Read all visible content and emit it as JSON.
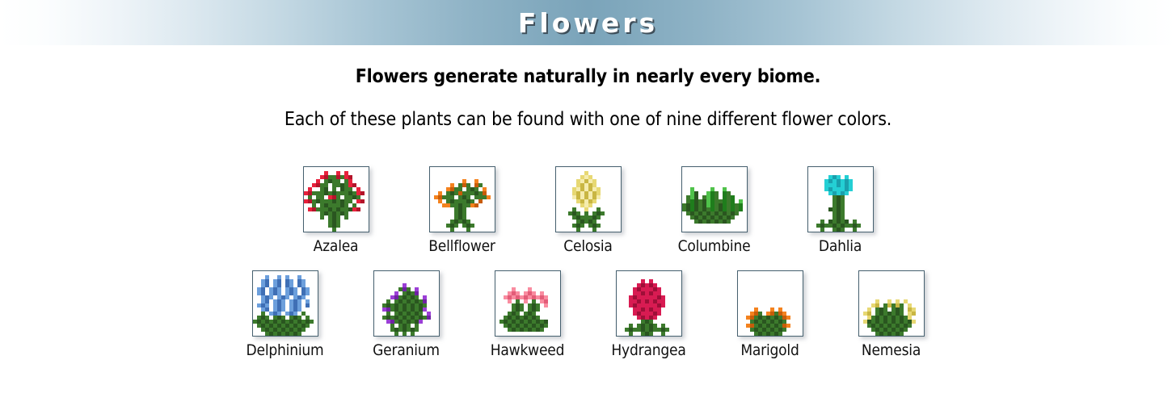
{
  "header": {
    "title": "Flowers",
    "accent_color": "#7ba4ba",
    "title_color": "#ffffff"
  },
  "intro": {
    "line1": "Flowers generate naturally in nearly every biome.",
    "line2": "Each of these plants can be found with one of nine different flower colors."
  },
  "flower_grid": {
    "rows": [
      {
        "items": [
          {
            "label": "Azalea",
            "icon": "azalea-flower-icon",
            "color": "#e8213c"
          },
          {
            "label": "Bellflower",
            "icon": "bellflower-flower-icon",
            "color": "#f08a1e"
          },
          {
            "label": "Celosia",
            "icon": "celosia-flower-icon",
            "color": "#e8d96a"
          },
          {
            "label": "Columbine",
            "icon": "columbine-flower-icon",
            "color": "#3fbf3f"
          },
          {
            "label": "Dahlia",
            "icon": "dahlia-flower-icon",
            "color": "#24cfd4"
          }
        ]
      },
      {
        "items": [
          {
            "label": "Delphinium",
            "icon": "delphinium-flower-icon",
            "color": "#6c9fdc"
          },
          {
            "label": "Geranium",
            "icon": "geranium-flower-icon",
            "color": "#9b3fd6"
          },
          {
            "label": "Hawkweed",
            "icon": "hawkweed-flower-icon",
            "color": "#f98ca0"
          },
          {
            "label": "Hydrangea",
            "icon": "hydrangea-flower-icon",
            "color": "#d81b52"
          },
          {
            "label": "Marigold",
            "icon": "marigold-flower-icon",
            "color": "#f47c1a"
          },
          {
            "label": "Nemesia",
            "icon": "nemesia-flower-icon",
            "color": "#efe06a"
          }
        ]
      }
    ]
  }
}
